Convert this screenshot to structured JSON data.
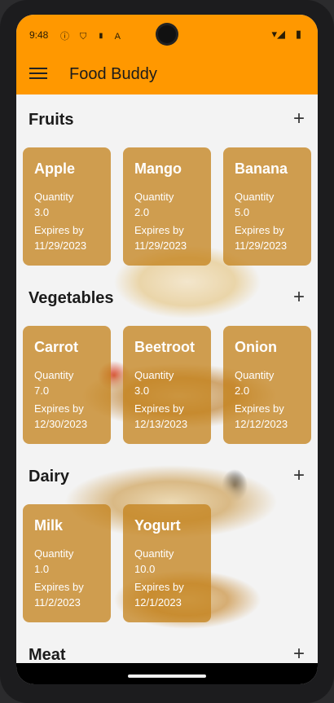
{
  "status_bar": {
    "time": "9:48",
    "icons": "ⓘ ⛉ ▮ A",
    "signal": "▾◢",
    "battery": "▮"
  },
  "app_bar": {
    "title": "Food Buddy",
    "menu_icon": "hamburger-menu-icon"
  },
  "labels": {
    "quantity": "Quantity",
    "expires": "Expires by",
    "add": "+"
  },
  "sections": [
    {
      "title": "Fruits",
      "items": [
        {
          "name": "Apple",
          "quantity": "3.0",
          "expires": "11/29/2023"
        },
        {
          "name": "Mango",
          "quantity": "2.0",
          "expires": "11/29/2023"
        },
        {
          "name": "Banana",
          "quantity": "5.0",
          "expires": "11/29/2023"
        }
      ]
    },
    {
      "title": "Vegetables",
      "items": [
        {
          "name": "Carrot",
          "quantity": "7.0",
          "expires": "12/30/2023"
        },
        {
          "name": "Beetroot",
          "quantity": "3.0",
          "expires": "12/13/2023"
        },
        {
          "name": "Onion",
          "quantity": "2.0",
          "expires": "12/12/2023"
        }
      ]
    },
    {
      "title": "Dairy",
      "items": [
        {
          "name": "Milk",
          "quantity": "1.0",
          "expires": "11/2/2023"
        },
        {
          "name": "Yogurt",
          "quantity": "10.0",
          "expires": "12/1/2023"
        }
      ]
    },
    {
      "title": "Meat",
      "items": []
    }
  ],
  "colors": {
    "primary": "#ff9800",
    "card": "#c4821c"
  }
}
